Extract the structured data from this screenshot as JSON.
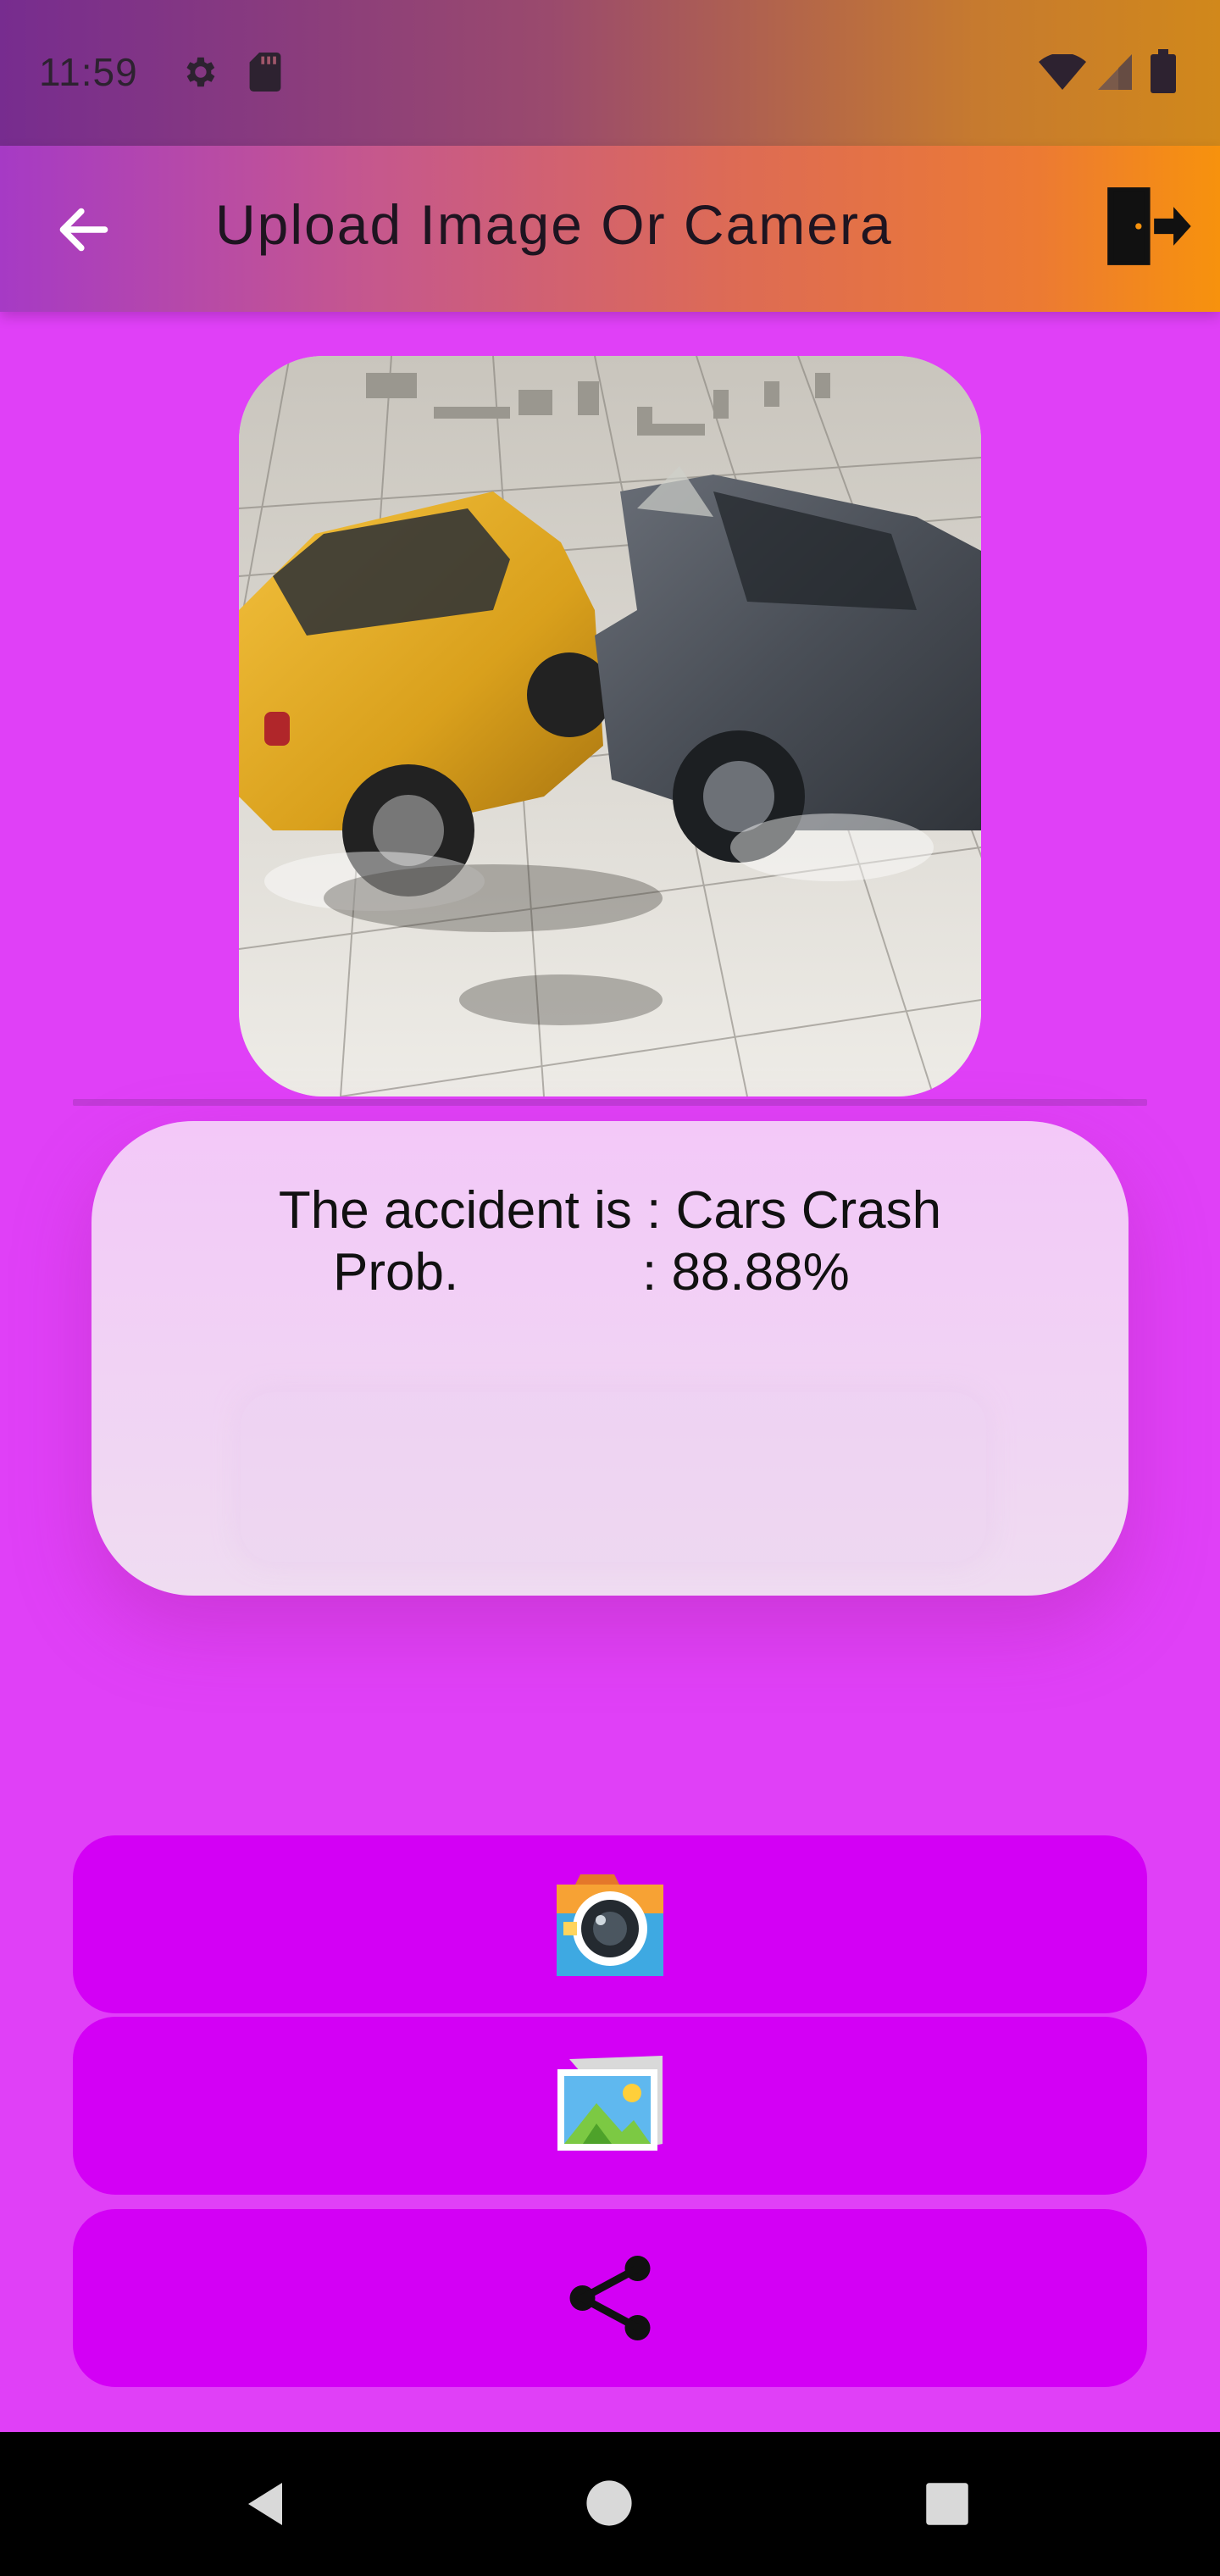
{
  "status_bar": {
    "time": "11:59",
    "icons": [
      "gear-icon",
      "sd-card-icon",
      "wifi-icon",
      "signal-icon",
      "battery-icon"
    ]
  },
  "app_bar": {
    "title": "Upload Image Or Camera",
    "back_icon": "arrow-back-icon",
    "exit_icon": "exit-door-icon",
    "gradient": [
      "#a63ac5",
      "#f7920d"
    ]
  },
  "image": {
    "icon": "photo-icon"
  },
  "result": {
    "line1": "The accident is : Cars Crash",
    "prob_label": "Prob.",
    "prob_value": ": 88.88%"
  },
  "buttons": [
    {
      "icon": "camera-icon"
    },
    {
      "icon": "gallery-icon"
    },
    {
      "icon": "share-icon"
    }
  ],
  "nav_bar": {
    "icons": [
      "nav-back-icon",
      "nav-home-icon",
      "nav-recents-icon"
    ]
  },
  "colors": {
    "background": "#e040f7",
    "button": "#d300f5",
    "card": "#f3c8f8"
  }
}
